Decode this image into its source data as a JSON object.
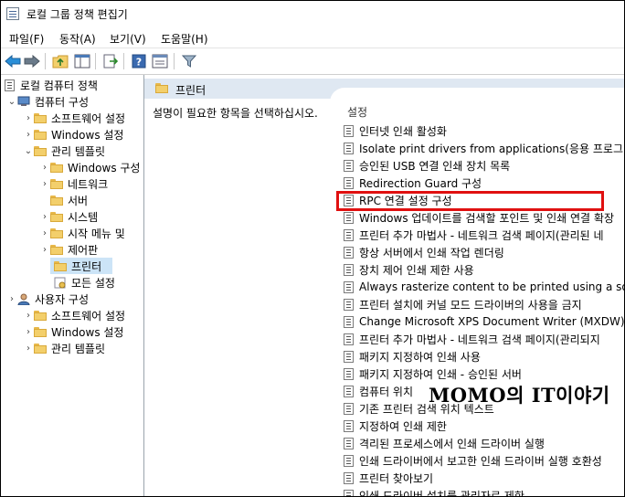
{
  "window": {
    "title": "로컬 그룹 정책 편집기"
  },
  "menu": [
    "파일(F)",
    "동작(A)",
    "보기(V)",
    "도움말(H)"
  ],
  "toolbar": {
    "icons": [
      "back-arrow-icon",
      "forward-arrow-icon",
      "up-folder-icon",
      "show-hide-tree-icon",
      "export-list-icon",
      "help-icon",
      "properties-icon",
      "filter-icon"
    ]
  },
  "tree": {
    "root": "로컬 컴퓨터 정책",
    "computer_config": "컴퓨터 구성",
    "cc_software": "소프트웨어 설정",
    "cc_windows": "Windows 설정",
    "cc_admin": "관리 템플릿",
    "admin_windows_components": "Windows 구성",
    "admin_network": "네트워크",
    "admin_server": "서버",
    "admin_system": "시스템",
    "admin_start_menu": "시작 메뉴 및",
    "admin_control_panel": "제어판",
    "admin_printers": "프린터",
    "admin_all_settings": "모든 설정",
    "user_config": "사용자 구성",
    "uc_software": "소프트웨어 설정",
    "uc_windows": "Windows 설정",
    "uc_admin": "관리 템플릿"
  },
  "content": {
    "header": "프린터",
    "description": "설명이 필요한 항목을 선택하십시오.",
    "column_header": "설정",
    "settings": [
      "인터넷 인쇄 활성화",
      "Isolate print drivers from applications(응용 프로그램에",
      "승인된 USB 연결 인쇄 장치 목록",
      "Redirection Guard 구성",
      "RPC 연결 설정 구성",
      "Windows 업데이트를 검색할 포인트 및 인쇄 연결 확장",
      "프린터 추가 마법사 - 네트워크 검색 페이지(관리된 네",
      "항상 서버에서 인쇄 작업 렌더링",
      "장치 제어 인쇄 제한 사용",
      "Always rasterize content to be printed using a software",
      "프린터 설치에 커널 모드 드라이버의 사용을 금지",
      "Change Microsoft XPS Document Writer (MXDW) defa",
      "프린터 추가 마법사 - 네트워크 검색 페이지(관리되지",
      "패키지 지정하여 인쇄 사용",
      "패키지 지정하여 인쇄 - 승인된 서버",
      "컴퓨터 위치",
      "기존 프린터 검색 위치 텍스트",
      "지정하여 인쇄 제한",
      "격리된 프로세스에서 인쇄 드라이버 실행",
      "인쇄 드라이버에서 보고한 인쇄 드라이버 실행 호환성",
      "프린터 찾아보기",
      "인쇄 드라이버 설치를 관리자로 제한"
    ]
  },
  "watermark": "MOMO의 IT이야기",
  "colors": {
    "highlight": "#e01010",
    "selection": "#cce4f7",
    "header": "#dfe8f2",
    "folder": "#f3cf6b"
  }
}
